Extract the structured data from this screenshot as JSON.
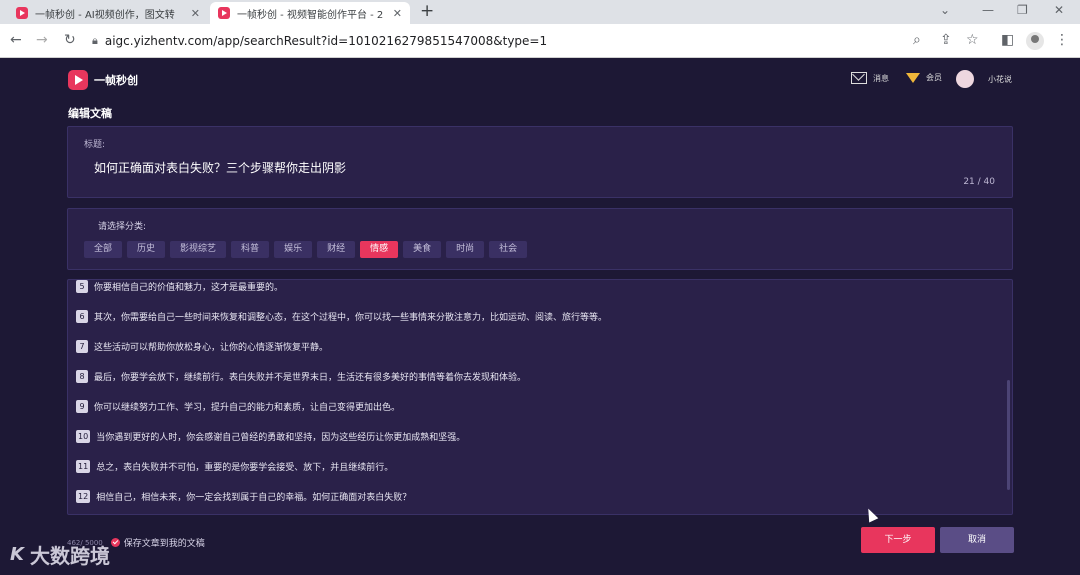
{
  "browser": {
    "tabs": [
      {
        "title": "一帧秒创 - AI视频创作，图文转"
      },
      {
        "title": "一帧秒创 - 视频智能创作平台 - 2"
      }
    ],
    "url": "aigc.yizhentv.com/app/searchResult?id=1010216279851547008&type=1"
  },
  "header": {
    "brand": "一帧秒创",
    "message_label": "消息",
    "vip_label": "会员",
    "user_name": "小花说"
  },
  "page_title": "编辑文稿",
  "title_field": {
    "label": "标题:",
    "value": "如何正确面对表白失败？三个步骤帮你走出阴影",
    "count": "21 / 40"
  },
  "category": {
    "label": "请选择分类:",
    "items": [
      "全部",
      "历史",
      "影视综艺",
      "科普",
      "娱乐",
      "财经",
      "情感",
      "美食",
      "时尚",
      "社会"
    ],
    "selected": "情感"
  },
  "lines": [
    {
      "n": "5",
      "text": "你要相信自己的价值和魅力，这才是最重要的。"
    },
    {
      "n": "6",
      "text": "其次，你需要给自己一些时间来恢复和调整心态，在这个过程中，你可以找一些事情来分散注意力，比如运动、阅读、旅行等等。"
    },
    {
      "n": "7",
      "text": "这些活动可以帮助你放松身心，让你的心情逐渐恢复平静。"
    },
    {
      "n": "8",
      "text": "最后，你要学会放下，继续前行。表白失败并不是世界末日，生活还有很多美好的事情等着你去发现和体验。"
    },
    {
      "n": "9",
      "text": "你可以继续努力工作、学习，提升自己的能力和素质，让自己变得更加出色。"
    },
    {
      "n": "10",
      "text": "当你遇到更好的人时，你会感谢自己曾经的勇敢和坚持，因为这些经历让你更加成熟和坚强。"
    },
    {
      "n": "11",
      "text": "总之，表白失败并不可怕，重要的是你要学会接受、放下，并且继续前行。"
    },
    {
      "n": "12",
      "text": "相信自己，相信未来，你一定会找到属于自己的幸福。如何正确面对表白失败？"
    }
  ],
  "footer": {
    "char_count": "462/ 5000",
    "save_label": "保存文章到我的文稿"
  },
  "buttons": {
    "next": "下一步",
    "cancel": "取消"
  },
  "watermark": {
    "mark": "K",
    "text": "大数跨境"
  }
}
